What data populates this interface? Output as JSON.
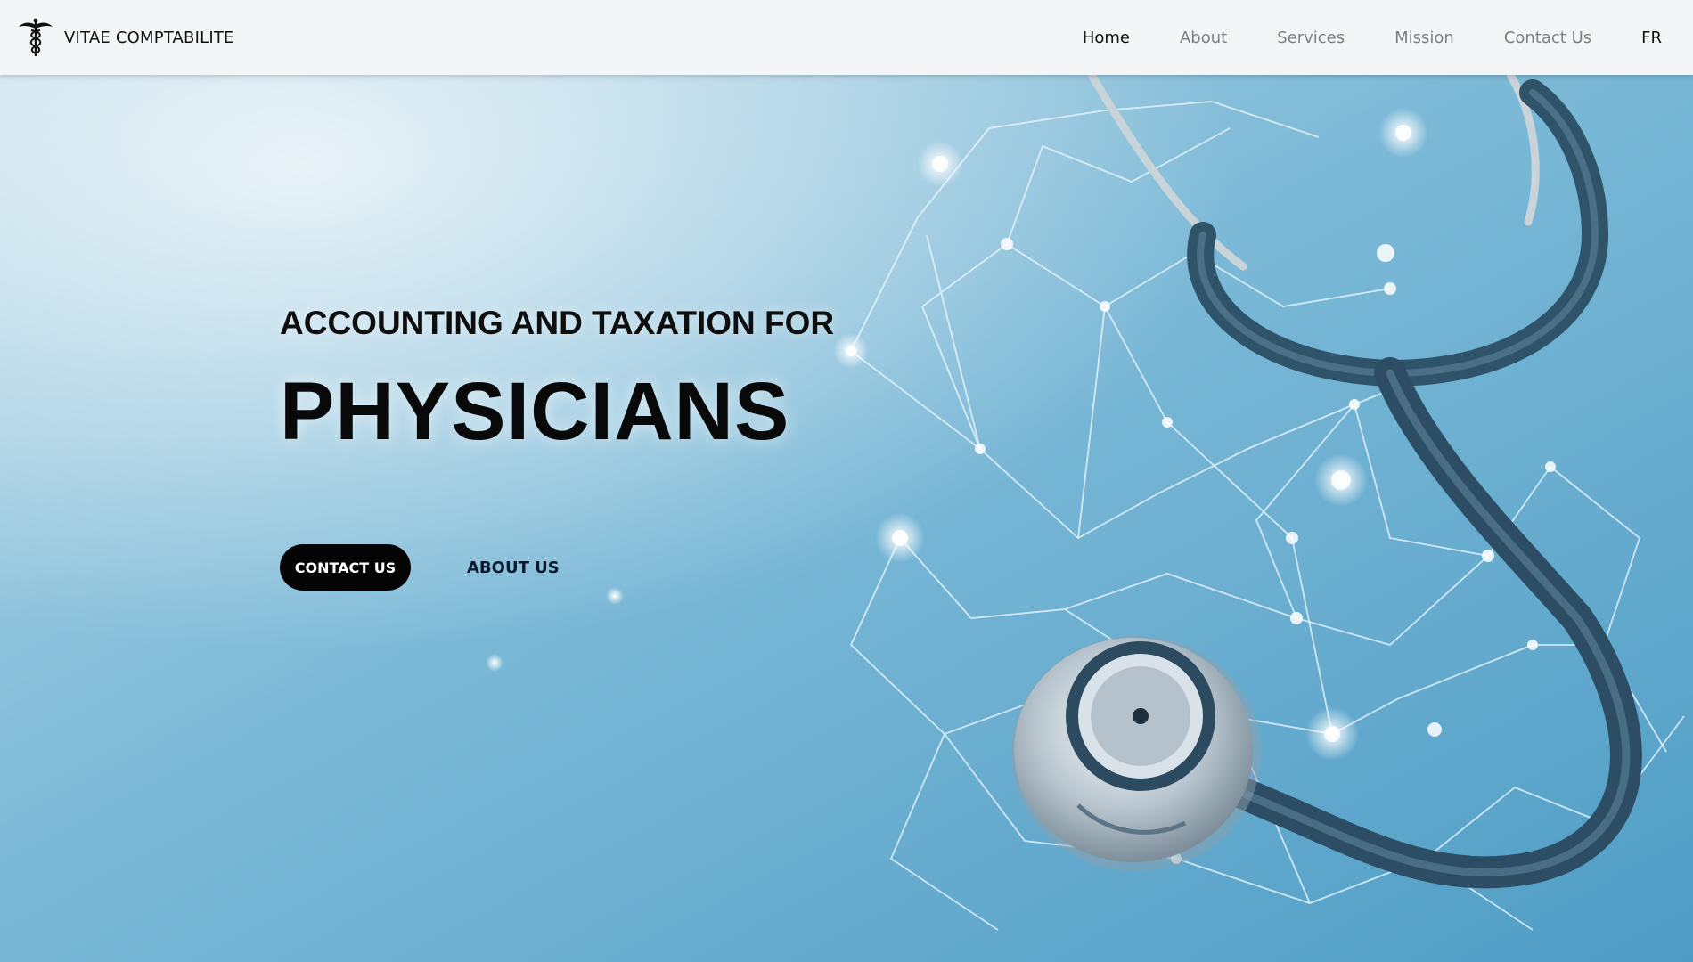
{
  "brand": {
    "name": "VITAE COMPTABILITE",
    "logo_icon": "caduceus-icon"
  },
  "nav": {
    "items": [
      {
        "label": "Home",
        "active": true
      },
      {
        "label": "About",
        "active": false
      },
      {
        "label": "Services",
        "active": false
      },
      {
        "label": "Mission",
        "active": false
      },
      {
        "label": "Contact Us",
        "active": false
      }
    ],
    "language": "FR"
  },
  "hero": {
    "subtitle": "ACCOUNTING AND TAXATION FOR",
    "title": "PHYSICIANS",
    "contact_button": "CONTACT US",
    "about_button": "ABOUT US",
    "background_image": "stethoscope-network-image"
  },
  "colors": {
    "nav_background": "#f4f5f6",
    "hero_blue": "#5fa9cc",
    "primary_button": "#050505",
    "nav_active": "#111111",
    "nav_inactive": "#7a7f86"
  }
}
